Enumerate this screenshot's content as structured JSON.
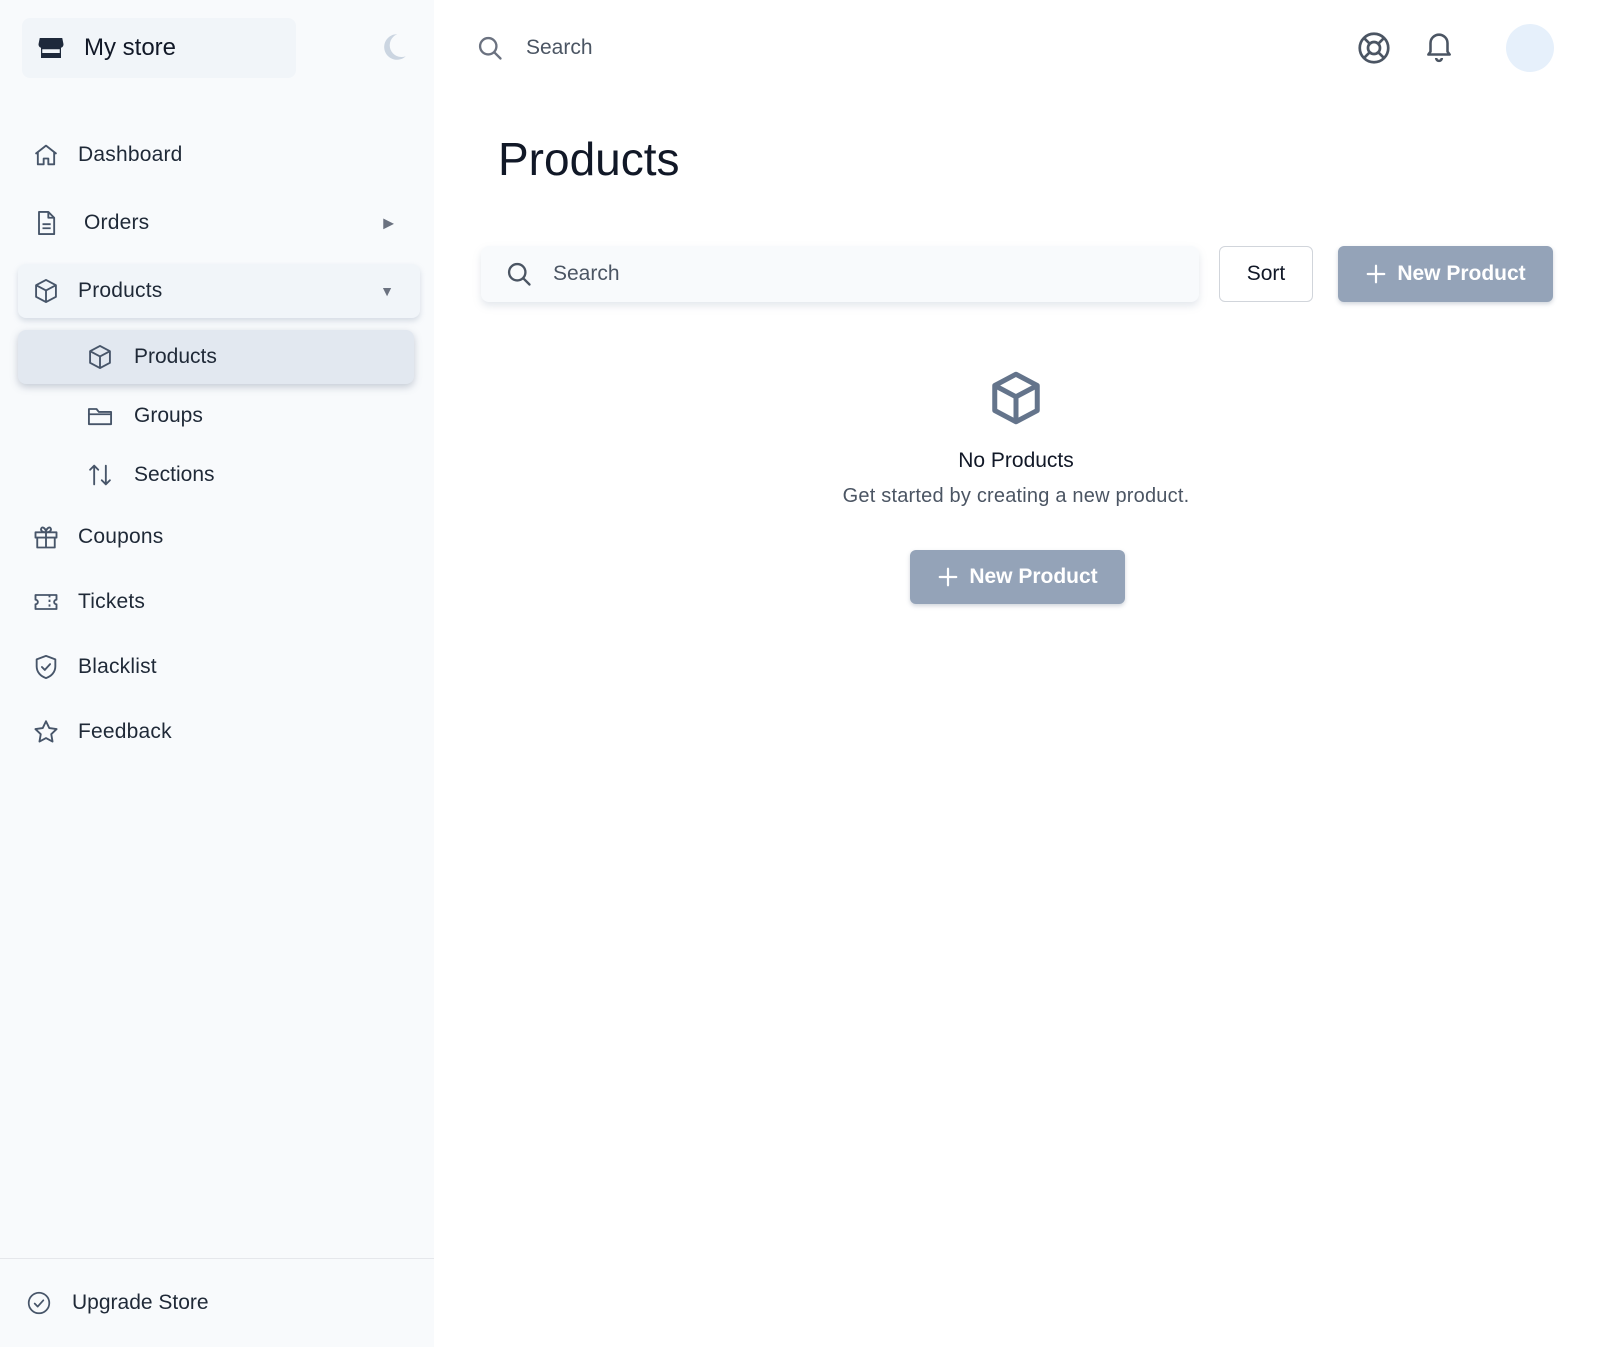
{
  "sidebar": {
    "store_name": "My store",
    "nav": {
      "dashboard": "Dashboard",
      "orders": "Orders",
      "products": "Products",
      "coupons": "Coupons",
      "tickets": "Tickets",
      "blacklist": "Blacklist",
      "feedback": "Feedback"
    },
    "products_sub": {
      "products": "Products",
      "groups": "Groups",
      "sections": "Sections"
    },
    "orders_caret": "▶",
    "products_caret": "▼",
    "footer": "Upgrade Store"
  },
  "header": {
    "search_placeholder": "Search"
  },
  "main": {
    "title": "Products",
    "search_placeholder": "Search",
    "sort_label": "Sort",
    "new_product_label": "New Product",
    "empty": {
      "title": "No Products",
      "subtitle": "Get started by creating a new product.",
      "button_label": "New Product"
    }
  },
  "icons": {
    "store": "store-icon",
    "moon": "moon-icon",
    "home": "home-icon",
    "document": "document-icon",
    "cube": "cube-icon",
    "folder": "folder-icon",
    "sort-arrows": "arrows-up-down-icon",
    "gift": "gift-icon",
    "ticket": "ticket-icon",
    "shield": "shield-check-icon",
    "star": "star-icon",
    "badge-check": "check-circle-icon",
    "search": "search-icon",
    "lifebuoy": "lifebuoy-icon",
    "bell": "bell-icon",
    "plus": "plus-icon"
  },
  "colors": {
    "sidebar_bg": "#f8fafc",
    "primary_button": "#94a3b8",
    "active_sub_bg": "#e2e8f0",
    "avatar_bg": "#e6f0fb"
  }
}
